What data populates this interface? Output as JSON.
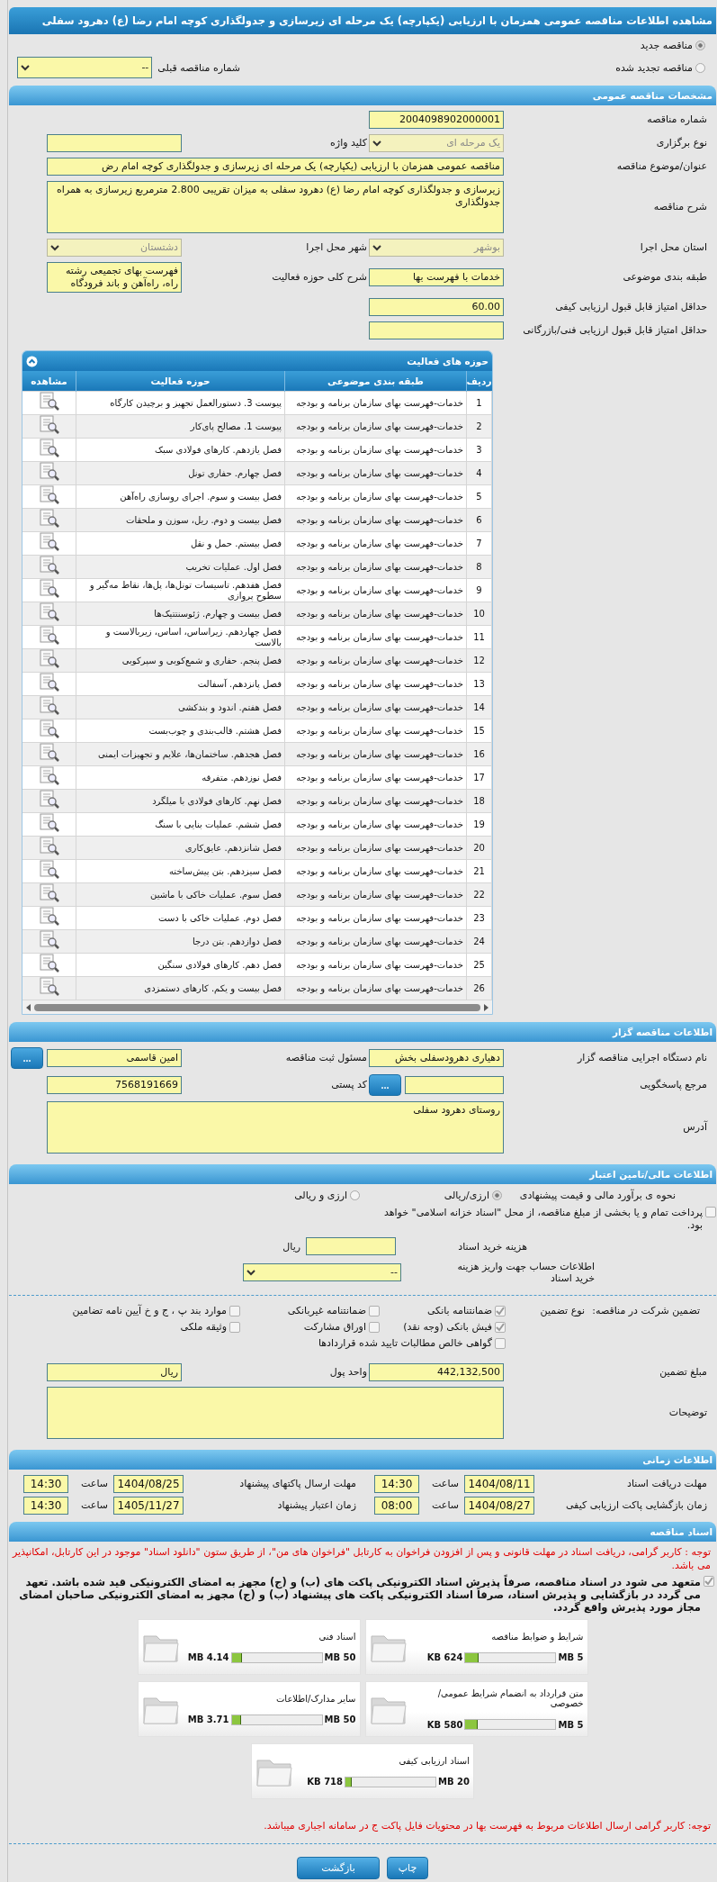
{
  "page_title": "مشاهده اطلاعات مناقصه عمومی همزمان با ارزیابی (یکپارچه) یک مرحله ای زیرسازی و جدولگذاری کوچه امام رضا (ع) دهرود سفلی",
  "tender_kind": [
    {
      "label": "مناقصه جدید",
      "selected": true
    },
    {
      "label": "مناقصه تجدید شده",
      "selected": false
    }
  ],
  "previous_tender": {
    "label": "شماره مناقصه قبلی",
    "value": "--",
    "disabled": false
  },
  "general": {
    "title": "مشخصات مناقصه عمومی",
    "rows": [
      [
        {
          "label": "شماره مناقصه",
          "kind": "text",
          "value": "2004098902000001"
        }
      ],
      [
        {
          "label": "نوع برگزاری",
          "kind": "select",
          "value": "یک مرحله ای",
          "disabled": true
        },
        {
          "label": "کلید واژه",
          "kind": "text"
        }
      ],
      [
        {
          "label": "عنوان/موضوع مناقصه",
          "kind": "wide_text",
          "value": "مناقصه عمومی همزمان با ارزیابی (یکپارچه) یک مرحله ای زیرسازی و جدولگذاری کوچه امام رض"
        }
      ],
      [
        {
          "label": "شرح مناقصه",
          "kind": "wide_textarea",
          "value": "زیرسازی و جدولگذاری کوچه امام رضا (ع) دهرود سفلی به میزان تقریبی 2.800 مترمربع زیرسازی به همراه جدولگذاری"
        }
      ],
      [
        {
          "label": "استان محل اجرا",
          "kind": "select",
          "value": "بوشهر",
          "disabled": true
        },
        {
          "label": "شهر محل اجرا",
          "kind": "select",
          "value": "دشتستان",
          "disabled": true
        }
      ],
      [
        {
          "label": "طبقه بندی موضوعی",
          "kind": "text",
          "value": "خدمات با فهرست بها"
        },
        {
          "label": "شرح کلی حوزه فعالیت",
          "kind": "textarea",
          "value": "فهرست بهای تجمیعی رشته راه، راه‌آهن و باند فرودگاه"
        }
      ],
      [
        {
          "label": "حداقل امتیاز قابل قبول ارزیابی کیفی",
          "kind": "text",
          "value": "60.00"
        }
      ],
      [
        {
          "label": "حداقل امتیاز قابل قبول ارزیابی فنی/بازرگانی",
          "kind": "text"
        }
      ]
    ]
  },
  "activities": {
    "title": "حوزه های فعالیت",
    "expanded": true,
    "columns": [
      "ردیف",
      "طبقه بندی موضوعی",
      "حوزه فعالیت",
      "مشاهده"
    ],
    "rows": [
      {
        "index": "1",
        "category": "خدمات-فهرست بهای سازمان برنامه و بودجه",
        "activity": "پیوست 3. دستورالعمل تجهیز و برچیدن کارگاه"
      },
      {
        "index": "2",
        "category": "خدمات-فهرست بهای سازمان برنامه و بودجه",
        "activity": "پیوست 1. مصالح پای‌کار"
      },
      {
        "index": "3",
        "category": "خدمات-فهرست بهای سازمان برنامه و بودجه",
        "activity": "فصل یازدهم. کارهای فولادی سبک"
      },
      {
        "index": "4",
        "category": "خدمات-فهرست بهای سازمان برنامه و بودجه",
        "activity": "فصل چهارم. حفاری تونل"
      },
      {
        "index": "5",
        "category": "خدمات-فهرست بهای سازمان برنامه و بودجه",
        "activity": "فصل بیست و سوم. اجرای روسازی راه‌آهن"
      },
      {
        "index": "6",
        "category": "خدمات-فهرست بهای سازمان برنامه و بودجه",
        "activity": "فصل بیست و دوم. ریل، سوزن و ملحقات"
      },
      {
        "index": "7",
        "category": "خدمات-فهرست بهای سازمان برنامه و بودجه",
        "activity": "فصل بیستم. حمل و نقل"
      },
      {
        "index": "8",
        "category": "خدمات-فهرست بهای سازمان برنامه و بودجه",
        "activity": "فصل اول. عملیات تخریب"
      },
      {
        "index": "9",
        "category": "خدمات-فهرست بهای سازمان برنامه و بودجه",
        "activity": "فصل هفدهم. تاسیسات تونل‌ها، پل‌ها، نقاط مه‌گیر و سطوح پروازی"
      },
      {
        "index": "10",
        "category": "خدمات-فهرست بهای سازمان برنامه و بودجه",
        "activity": "فصل بیست و چهارم. ژئوسنتتیک‌ها"
      },
      {
        "index": "11",
        "category": "خدمات-فهرست بهای سازمان برنامه و بودجه",
        "activity": "فصل چهاردهم. زیراساس، اساس، زیربالاست و بالاست"
      },
      {
        "index": "12",
        "category": "خدمات-فهرست بهای سازمان برنامه و بودجه",
        "activity": "فصل پنجم. حفاری و شمع‌کوبی و سپرکوبی"
      },
      {
        "index": "13",
        "category": "خدمات-فهرست بهای سازمان برنامه و بودجه",
        "activity": "فصل پانزدهم. آسفالت"
      },
      {
        "index": "14",
        "category": "خدمات-فهرست بهای سازمان برنامه و بودجه",
        "activity": "فصل هفتم. اندود و بندکشی"
      },
      {
        "index": "15",
        "category": "خدمات-فهرست بهای سازمان برنامه و بودجه",
        "activity": "فصل هشتم. قالب‌بندی و چوب‌بست"
      },
      {
        "index": "16",
        "category": "خدمات-فهرست بهای سازمان برنامه و بودجه",
        "activity": "فصل هجدهم. ساختمان‌ها، علایم و تجهیزات ایمنی"
      },
      {
        "index": "17",
        "category": "خدمات-فهرست بهای سازمان برنامه و بودجه",
        "activity": "فصل نوزدهم. متفرقه"
      },
      {
        "index": "18",
        "category": "خدمات-فهرست بهای سازمان برنامه و بودجه",
        "activity": "فصل نهم. کارهای فولادی با میلگرد"
      },
      {
        "index": "19",
        "category": "خدمات-فهرست بهای سازمان برنامه و بودجه",
        "activity": "فصل ششم. عملیات بنایی با سنگ"
      },
      {
        "index": "20",
        "category": "خدمات-فهرست بهای سازمان برنامه و بودجه",
        "activity": "فصل شانزدهم. عایق‌کاری"
      },
      {
        "index": "21",
        "category": "خدمات-فهرست بهای سازمان برنامه و بودجه",
        "activity": "فصل سیزدهم. بتن پیش‌ساخته"
      },
      {
        "index": "22",
        "category": "خدمات-فهرست بهای سازمان برنامه و بودجه",
        "activity": "فصل سوم. عملیات خاکی با ماشین"
      },
      {
        "index": "23",
        "category": "خدمات-فهرست بهای سازمان برنامه و بودجه",
        "activity": "فصل دوم. عملیات خاکی با دست"
      },
      {
        "index": "24",
        "category": "خدمات-فهرست بهای سازمان برنامه و بودجه",
        "activity": "فصل دوازدهم. بتن درجا"
      },
      {
        "index": "25",
        "category": "خدمات-فهرست بهای سازمان برنامه و بودجه",
        "activity": "فصل دهم. کارهای فولادی سنگین"
      },
      {
        "index": "26",
        "category": "خدمات-فهرست بهای سازمان برنامه و بودجه",
        "activity": "فصل بیست و یکم. کارهای دستمزدی"
      }
    ]
  },
  "organizer": {
    "title": "اطلاعات مناقصه گزار",
    "rows": [
      [
        {
          "label": "نام دستگاه اجرایی مناقصه گزار",
          "kind": "text",
          "value": "دهیاری دهرودسفلی بخش"
        },
        {
          "label": "مسئول ثبت مناقصه",
          "kind": "text",
          "value": "امین قاسمی",
          "action": "..."
        }
      ],
      [
        {
          "label": "مرجع پاسخگویی",
          "kind": "text",
          "action": "..."
        },
        {
          "label": "کد پستی",
          "kind": "text",
          "value": "7568191669"
        }
      ],
      [
        {
          "label": "آدرس",
          "kind": "wide_textarea",
          "value": "روستای دهرود سفلی"
        }
      ]
    ]
  },
  "finance": {
    "title": "اطلاعات مالی/تامین اعتبار",
    "estimate": {
      "label": "نحوه ی برآورد مالی و قیمت پیشنهادی",
      "options": [
        {
          "label": "ارزی/ریالی",
          "selected": true
        },
        {
          "label": "ارزی و ریالی",
          "selected": false
        }
      ]
    },
    "treasury": {
      "label": "پرداخت تمام و یا بخشی از مبلغ مناقصه، از محل \"اسناد خزانه اسلامی\" خواهد بود.",
      "checked": false
    },
    "document_cost": {
      "label": "هزینه خرید اسناد",
      "unit": "ریال"
    },
    "account": {
      "label": "اطلاعات حساب جهت واریز هزینه خرید اسناد",
      "value": "--",
      "disabled": false
    },
    "guarantee": {
      "label": "تضمین شرکت در مناقصه:",
      "type_label": "نوع تضمین",
      "options": [
        {
          "label": "ضمانتنامه بانکی",
          "checked": true
        },
        {
          "label": "ضمانتنامه غیربانکی",
          "checked": false
        },
        {
          "label": "موارد بند پ ، ج و خ آیین نامه تضامین",
          "checked": false
        },
        {
          "label": "فیش بانکی (وجه نقد)",
          "checked": true
        },
        {
          "label": "اوراق مشارکت",
          "checked": false
        },
        {
          "label": "وثیقه ملکی",
          "checked": false
        },
        {
          "label": "گواهی خالص مطالبات تایید شده قراردادها",
          "checked": false
        }
      ]
    },
    "rows": [
      [
        {
          "label": "مبلغ تضمین",
          "kind": "text",
          "value": "442,132,500"
        },
        {
          "label": "واحد پول",
          "kind": "text",
          "value": "ریال"
        }
      ],
      [
        {
          "label": "توضیحات",
          "kind": "wide_textarea"
        }
      ]
    ]
  },
  "schedule": {
    "title": "اطلاعات زمانی",
    "items": [
      {
        "label": "مهلت دریافت اسناد",
        "date": "1404/08/11",
        "time_label": "ساعت",
        "time": "14:30"
      },
      {
        "label": "مهلت ارسال پاکتهای پیشنهاد",
        "date": "1404/08/25",
        "time_label": "ساعت",
        "time": "14:30"
      },
      {
        "label": "زمان بازگشایی پاکت ارزیابی کیفی",
        "date": "1404/08/27",
        "time_label": "ساعت",
        "time": "08:00"
      },
      {
        "label": "زمان اعتبار پیشنهاد",
        "date": "1405/11/27",
        "time_label": "ساعت",
        "time": "14:30"
      }
    ]
  },
  "documents": {
    "title": "اسناد مناقصه",
    "notice": "توجه : کاربر گرامی، دریافت اسناد در مهلت قانونی و پس از افزودن فراخوان به کارتابل \"فراخوان های من\"، از طریق ستون \"دانلود اسناد\" موجود در این کارتابل، امکانپذیر می باشد.",
    "commitment": {
      "text": "متعهد می شود در اسناد مناقصه، صرفاً پذیرش اسناد الکترونیکی پاکت های (ب) و (ج) مجهز به امضای الکترونیکی قید شده باشد. تعهد می گردد در بازگشایی و پذیرش اسناد، صرفاً اسناد الکترونیکی پاکت های پیشنهاد (ب) و (ج) مجهز به امضای الکترونیکی صاحبان امضای مجاز مورد پذیرش واقع گردد.",
      "checked": true
    },
    "files": [
      {
        "name": "شرایط و ضوابط مناقصه",
        "size": "624 KB",
        "max": "5 MB",
        "level": 0.14
      },
      {
        "name": "اسناد فنی",
        "size": "4.14 MB",
        "max": "50 MB",
        "level": 0.1
      },
      {
        "name": "متن قرارداد به انضمام شرایط عمومی/خصوصی",
        "size": "580 KB",
        "max": "5 MB",
        "level": 0.13
      },
      {
        "name": "سایر مدارک/اطلاعات",
        "size": "3.71 MB",
        "max": "50 MB",
        "level": 0.09
      },
      {
        "name": "اسناد ارزیابی کیفی",
        "size": "718 KB",
        "max": "20 MB",
        "level": 0.06
      }
    ],
    "footer_note": "توجه: کاربر گرامی ارسال اطلاعات مربوط به فهرست بها در محتویات فایل پاکت ج در سامانه اجباری میباشد."
  },
  "actions": [
    "چاپ",
    "بازگشت"
  ]
}
